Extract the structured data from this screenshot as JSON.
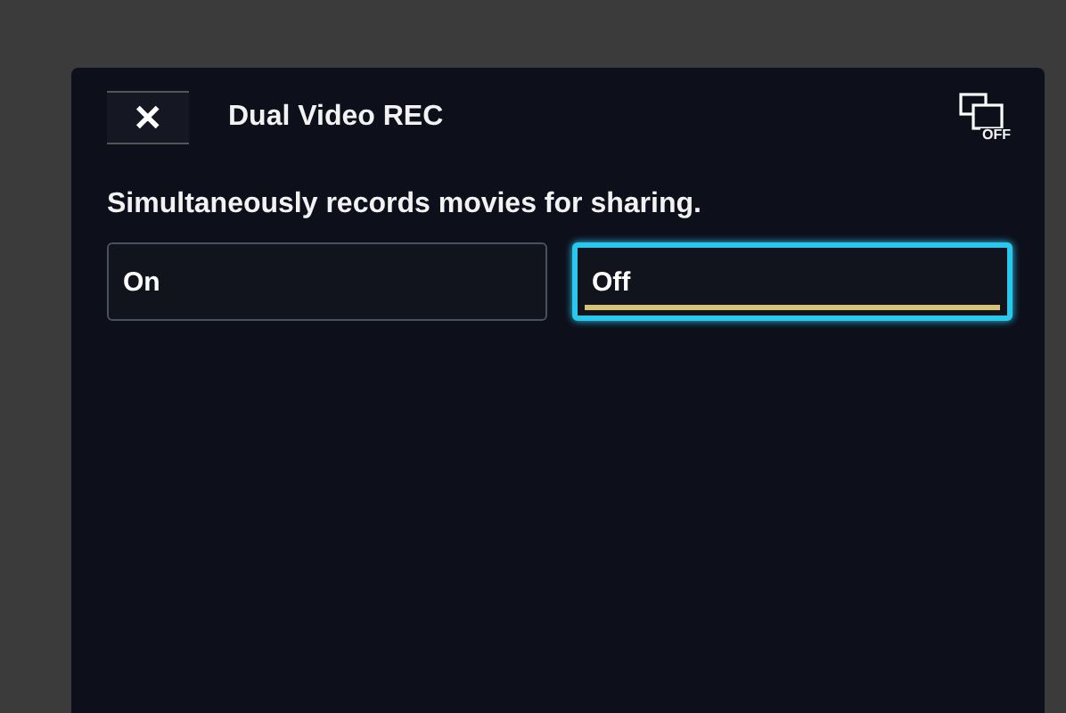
{
  "header": {
    "close": "✕",
    "title": "Dual Video REC",
    "status_icon_label": "OFF"
  },
  "description": "Simultaneously records movies for sharing.",
  "options": [
    {
      "label": "On",
      "selected": false,
      "current": false
    },
    {
      "label": "Off",
      "selected": true,
      "current": true
    }
  ]
}
